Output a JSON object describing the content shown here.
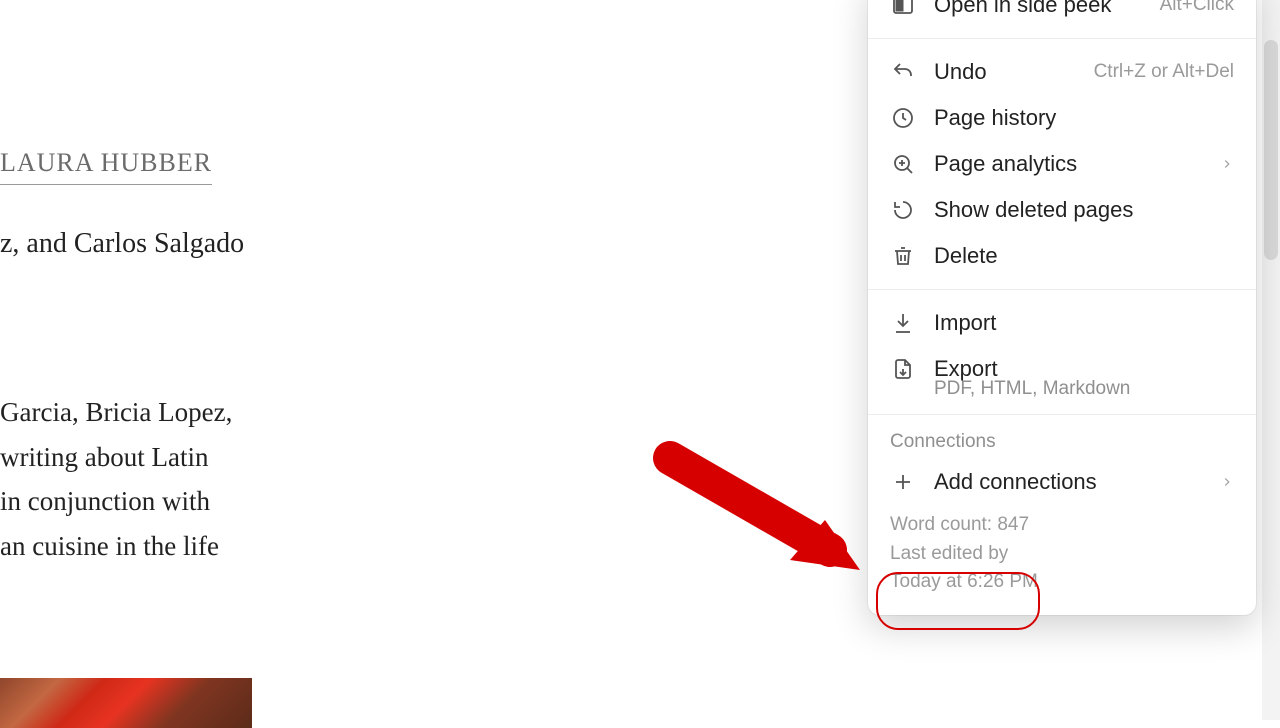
{
  "doc": {
    "author": "LAURA HUBBER",
    "line1": "z, and Carlos Salgado",
    "para_lines": [
      "Garcia, Bricia Lopez,",
      "writing about Latin",
      " in conjunction with",
      "an cuisine in the life"
    ]
  },
  "menu": {
    "open_side_peek": "Open in side peek",
    "open_side_peek_shortcut": "Alt+Click",
    "undo": "Undo",
    "undo_shortcut": "Ctrl+Z or Alt+Del",
    "page_history": "Page history",
    "page_analytics": "Page analytics",
    "show_deleted": "Show deleted pages",
    "delete": "Delete",
    "import": "Import",
    "export": "Export",
    "export_sub": "PDF, HTML, Markdown",
    "connections_label": "Connections",
    "add_connections": "Add connections",
    "word_count": "Word count: 847",
    "last_edited_by": "Last edited by",
    "last_edited_time": "Today at 6:26 PM"
  }
}
